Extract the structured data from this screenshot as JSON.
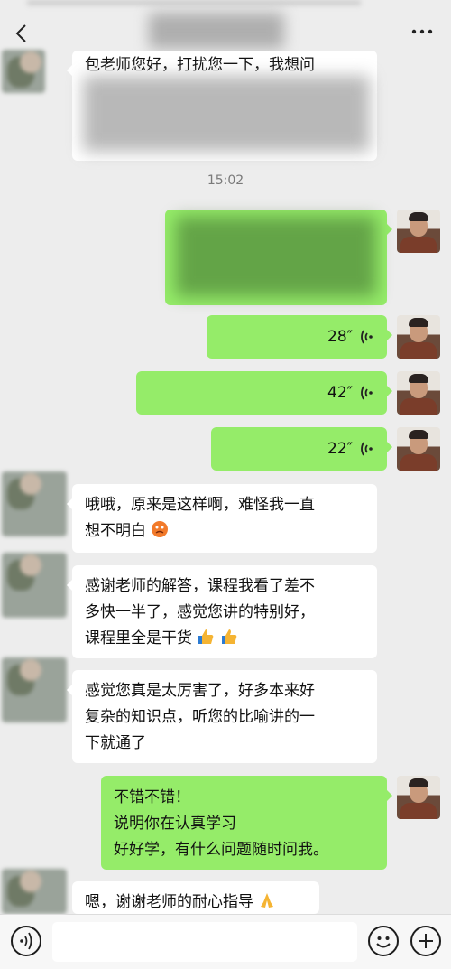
{
  "header": {
    "back_icon": "chevron-left-icon",
    "more_icon": "more-dots-icon"
  },
  "messages": {
    "m1_line1": "包老师您好，打扰您一下，我想问",
    "time_divider": "15:02",
    "voice1": "28″",
    "voice2": "42″",
    "voice3": "22″",
    "m3_line1": "哦哦，原来是这样啊，难怪我一直",
    "m3_line2": "想不明白",
    "m4_line1": "感谢老师的解答，课程我看了差不",
    "m4_line2": "多快一半了，感觉您讲的特别好，",
    "m4_line3": "课程里全是干货",
    "m5_line1": "感觉您真是太厉害了，好多本来好",
    "m5_line2": "复杂的知识点，听您的比喻讲的一",
    "m5_line3": "下就通了",
    "m6_line1": "不错不错！",
    "m6_line2": "说明你在认真学习",
    "m6_line3": "好好学，有什么问题随时问我。",
    "m7_line1": "嗯，谢谢老师的耐心指导"
  },
  "bottom_bar": {
    "voice_icon": "voice-input-icon",
    "emoji_icon": "emoji-icon",
    "plus_icon": "plus-icon",
    "input_placeholder": ""
  },
  "colors": {
    "sent_bubble": "#95ec69",
    "received_bubble": "#ffffff",
    "background": "#ededed"
  }
}
